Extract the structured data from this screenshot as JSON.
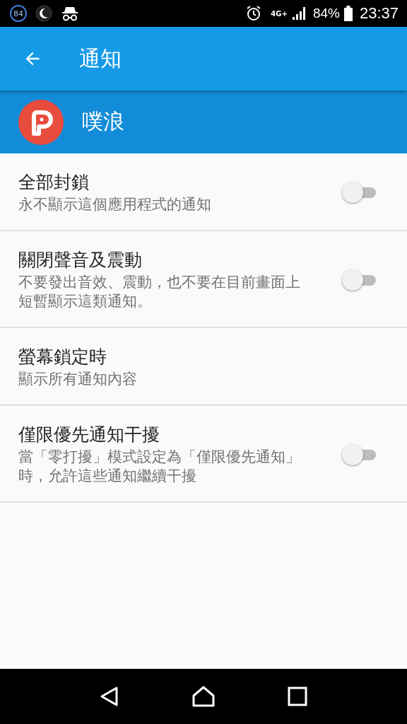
{
  "status_bar": {
    "badge": "84",
    "network": "4G+",
    "battery": "84%",
    "time": "23:37"
  },
  "toolbar": {
    "title": "通知"
  },
  "app": {
    "name": "噗浪"
  },
  "settings": [
    {
      "kind": "switch",
      "title": "全部封鎖",
      "summary": "永不顯示這個應用程式的通知",
      "on": false
    },
    {
      "kind": "switch",
      "title": "關閉聲音及震動",
      "summary": "不要發出音效、震動，也不要在目前畫面上短暫顯示這類通知。",
      "on": false
    },
    {
      "kind": "plain",
      "title": "螢幕鎖定時",
      "summary": "顯示所有通知內容"
    },
    {
      "kind": "switch",
      "title": "僅限優先通知干擾",
      "summary": "當「零打擾」模式設定為「僅限優先通知」時，允許這些通知繼續干擾",
      "on": false
    }
  ]
}
